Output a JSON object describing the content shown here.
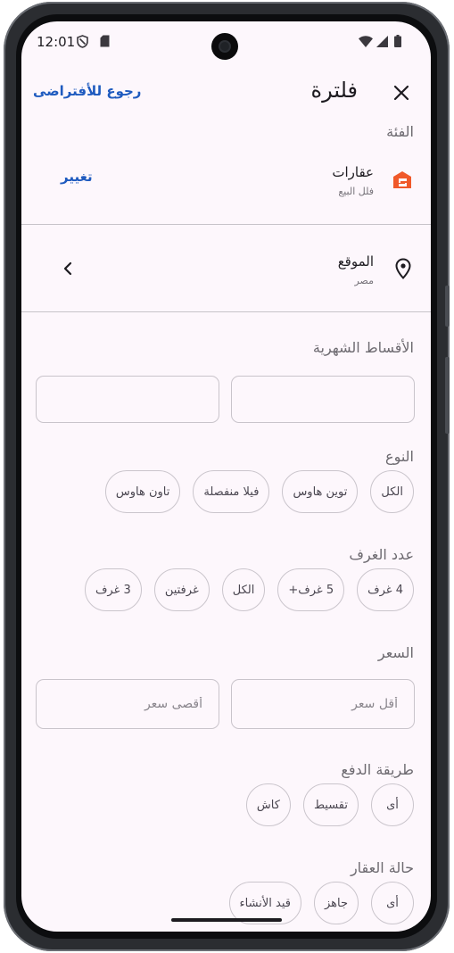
{
  "status_bar": {
    "time": "12:01"
  },
  "header": {
    "title": "فلترة",
    "reset_label": "رجوع للأفتراضى"
  },
  "category": {
    "section_label": "الفئة",
    "name": "عقارات",
    "subcategory": "فلل البيع",
    "change_label": "تغيير"
  },
  "location": {
    "label": "الموقع",
    "value": "مصر"
  },
  "installments": {
    "label": "الأقساط الشهرية",
    "min_value": "",
    "max_value": ""
  },
  "type": {
    "label": "النوع",
    "options": [
      "الكل",
      "توين هاوس",
      "فيلا منفصلة",
      "تاون هاوس"
    ]
  },
  "rooms": {
    "label": "عدد الغرف",
    "options": [
      "4 غرف",
      "5 غرف+",
      "الكل",
      "غرفتين",
      "3 غرف"
    ]
  },
  "price": {
    "label": "السعر",
    "min_placeholder": "أقل سعر",
    "max_placeholder": "أقصى سعر"
  },
  "payment": {
    "label": "طريقة الدفع",
    "options": [
      "أى",
      "تقسيط",
      "كاش"
    ]
  },
  "condition": {
    "label": "حالة العقار",
    "options": [
      "أى",
      "جاهز",
      "قيد الأنشاء"
    ]
  },
  "colors": {
    "accent": "#1f5bbf",
    "category_icon": "#f0592a",
    "background": "#fdf7fc"
  },
  "icons": {
    "close": "close-icon",
    "category": "real-estate-icon",
    "location": "location-pin-icon",
    "chevron": "chevron-left-icon"
  }
}
